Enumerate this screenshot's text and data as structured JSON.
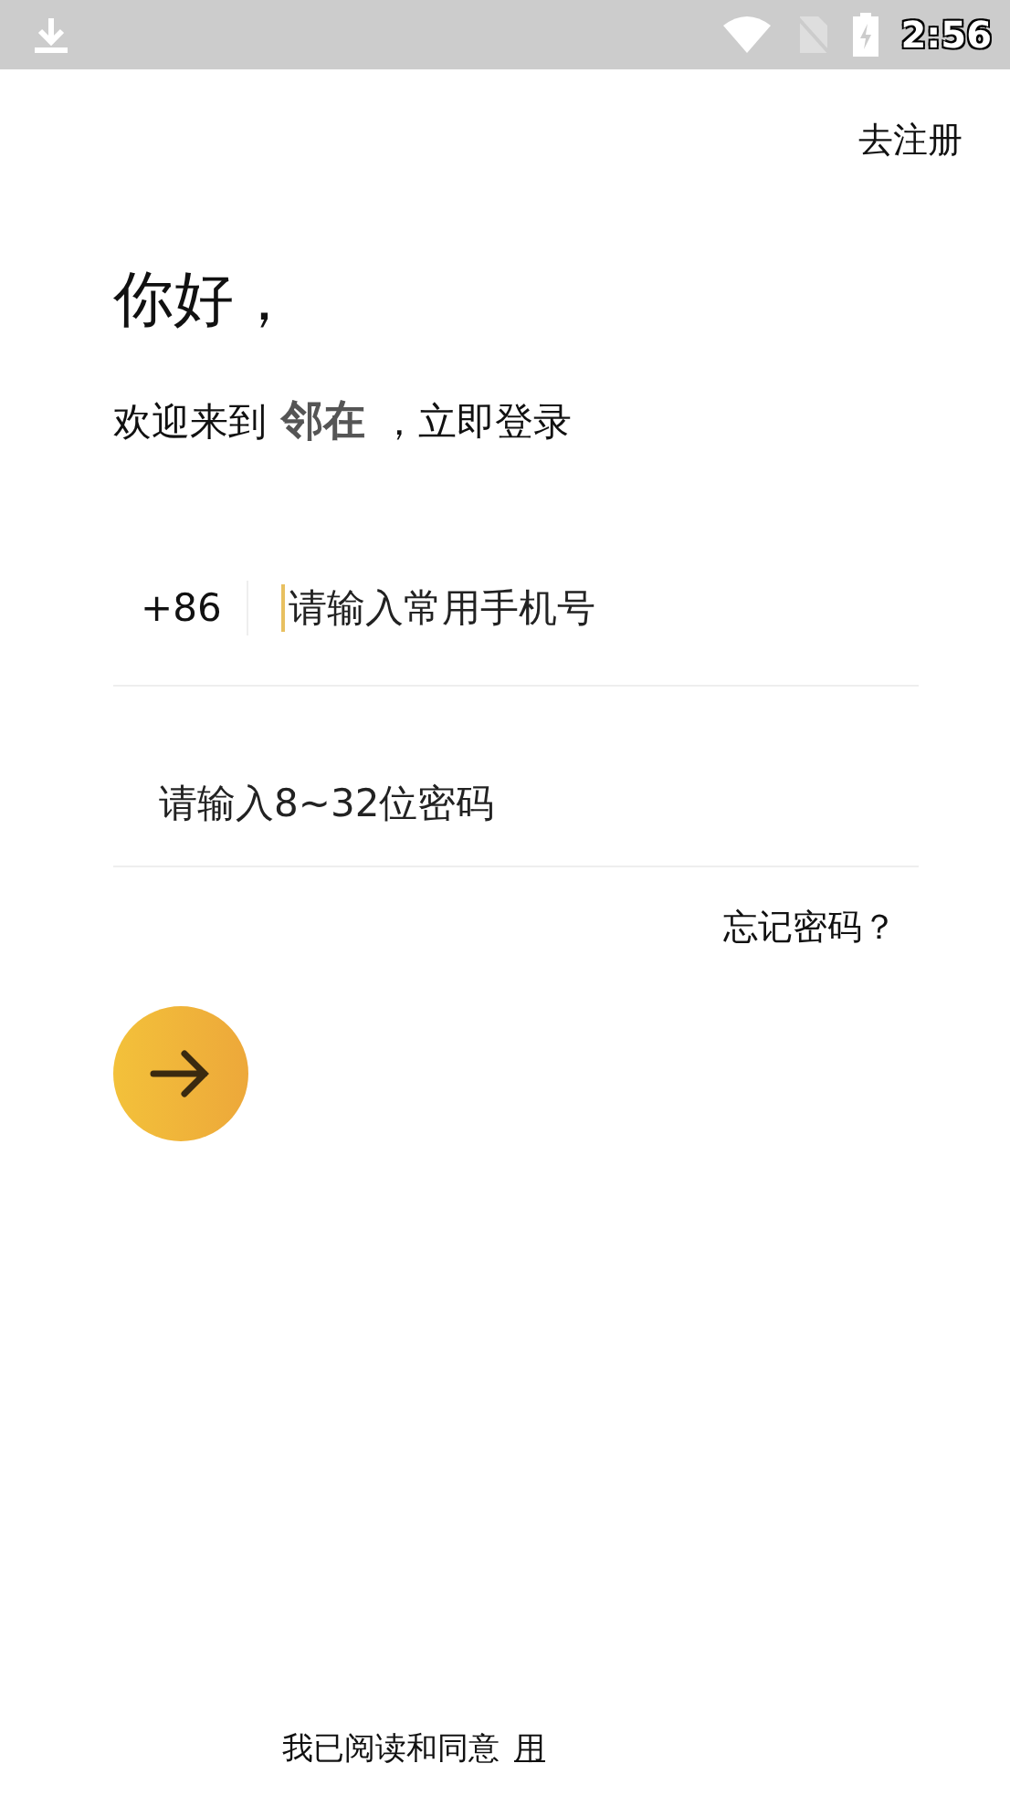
{
  "status_bar": {
    "time": "2:56"
  },
  "register_link": "去注册",
  "greeting": "你好，",
  "welcome": {
    "before": "欢迎来到",
    "app_name": "邻在",
    "after": "，立即登录"
  },
  "phone": {
    "country_code": "+86",
    "placeholder": "请输入常用手机号"
  },
  "password": {
    "placeholder": "请输入8~32位密码"
  },
  "forgot_link": "忘记密码？",
  "agreement": {
    "text": "我已阅读和同意",
    "link": "用"
  }
}
